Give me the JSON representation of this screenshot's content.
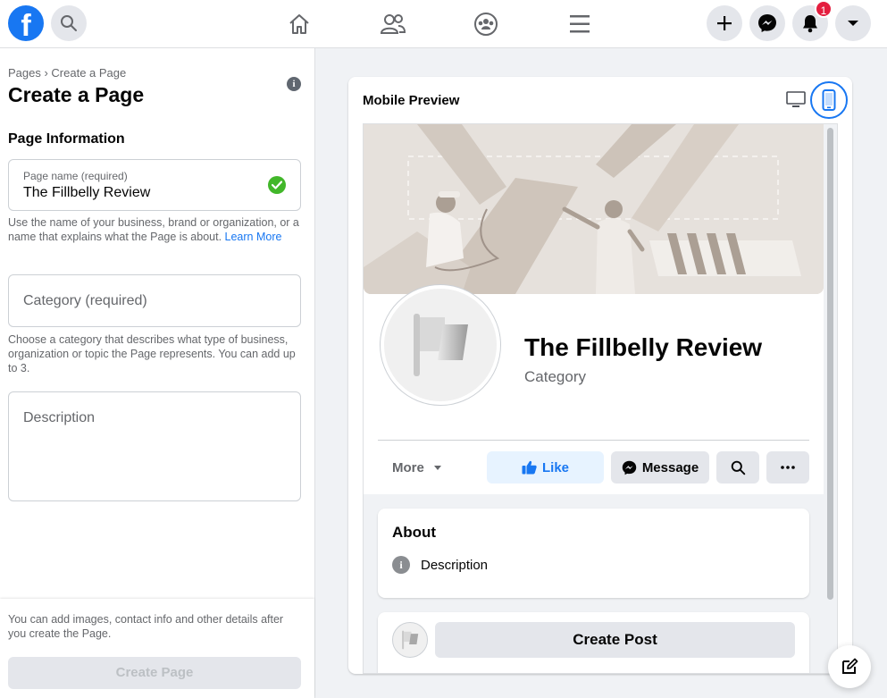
{
  "topbar": {
    "logo_letter": "f",
    "notification_count": "1",
    "icons": [
      "search-icon",
      "home-icon",
      "friends-icon",
      "groups-icon",
      "menu-icon",
      "plus-icon",
      "messenger-icon",
      "bell-icon",
      "caret-down-icon"
    ]
  },
  "left": {
    "breadcrumb": "Pages › Create a Page",
    "title": "Create a Page",
    "info_glyph": "i",
    "section_title": "Page Information",
    "page_name": {
      "label": "Page name (required)",
      "value": "The Fillbelly Review"
    },
    "page_name_help": "Use the name of your business, brand or organization, or a name that explains what the Page is about. ",
    "learn_more": "Learn More",
    "category": {
      "placeholder": "Category (required)"
    },
    "category_help": "Choose a category that describes what type of business, organization or topic the Page represents. You can add up to 3.",
    "description": {
      "placeholder": "Description"
    },
    "footer_note": "You can add images, contact info and other details after you create the Page.",
    "create_page_label": "Create Page"
  },
  "preview": {
    "title": "Mobile Preview",
    "page_name": "The Fillbelly Review",
    "category": "Category",
    "more_label": "More",
    "like_label": "Like",
    "message_label": "Message",
    "about_title": "About",
    "about_description": "Description",
    "create_post_label": "Create Post"
  },
  "colors": {
    "brand": "#1877f2",
    "like_bg": "#e7f3ff",
    "button_grey": "#e4e6eb",
    "success": "#42b72a",
    "badge": "#e41e3f"
  }
}
